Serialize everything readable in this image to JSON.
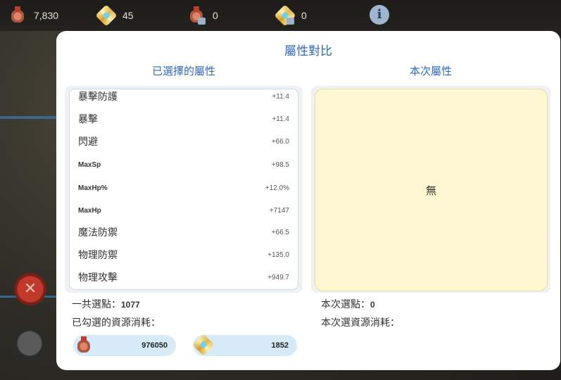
{
  "resources": [
    {
      "icon": "medal-icon",
      "value": "7,830"
    },
    {
      "icon": "gear-crystal-icon",
      "value": "45"
    },
    {
      "icon": "locked-medal-icon",
      "value": "0"
    },
    {
      "icon": "locked-gear-crystal-icon",
      "value": "0"
    }
  ],
  "info_icon": "i",
  "modal": {
    "title": "屬性對比",
    "left_header": "已選擇的屬性",
    "right_header": "本次屬性",
    "attributes": [
      {
        "name": "暴擊防護",
        "value": "+11.4"
      },
      {
        "name": "暴擊",
        "value": "+11.4"
      },
      {
        "name": "閃避",
        "value": "+66.0"
      },
      {
        "name": "MaxSp",
        "value": "+98.5"
      },
      {
        "name": "MaxHp%",
        "value": "+12.0%"
      },
      {
        "name": "MaxHp",
        "value": "+7147"
      },
      {
        "name": "魔法防禦",
        "value": "+66.5"
      },
      {
        "name": "物理防禦",
        "value": "+135.0"
      },
      {
        "name": "物理攻擊",
        "value": "+949.7"
      }
    ],
    "current_attributes_text": "無",
    "total_points_label": "一共選點：",
    "total_points_value": "1077",
    "selected_cost_label": "已勾選的資源消耗：",
    "cost_medal_value": "976050",
    "cost_gear_value": "1852",
    "current_points_label": "本次選點：",
    "current_points_value": "0",
    "current_cost_label": "本次選資源消耗："
  },
  "colors": {
    "accent": "#2f68b4",
    "pill": "#d7eaf8",
    "current_panel": "#fff7d2"
  }
}
